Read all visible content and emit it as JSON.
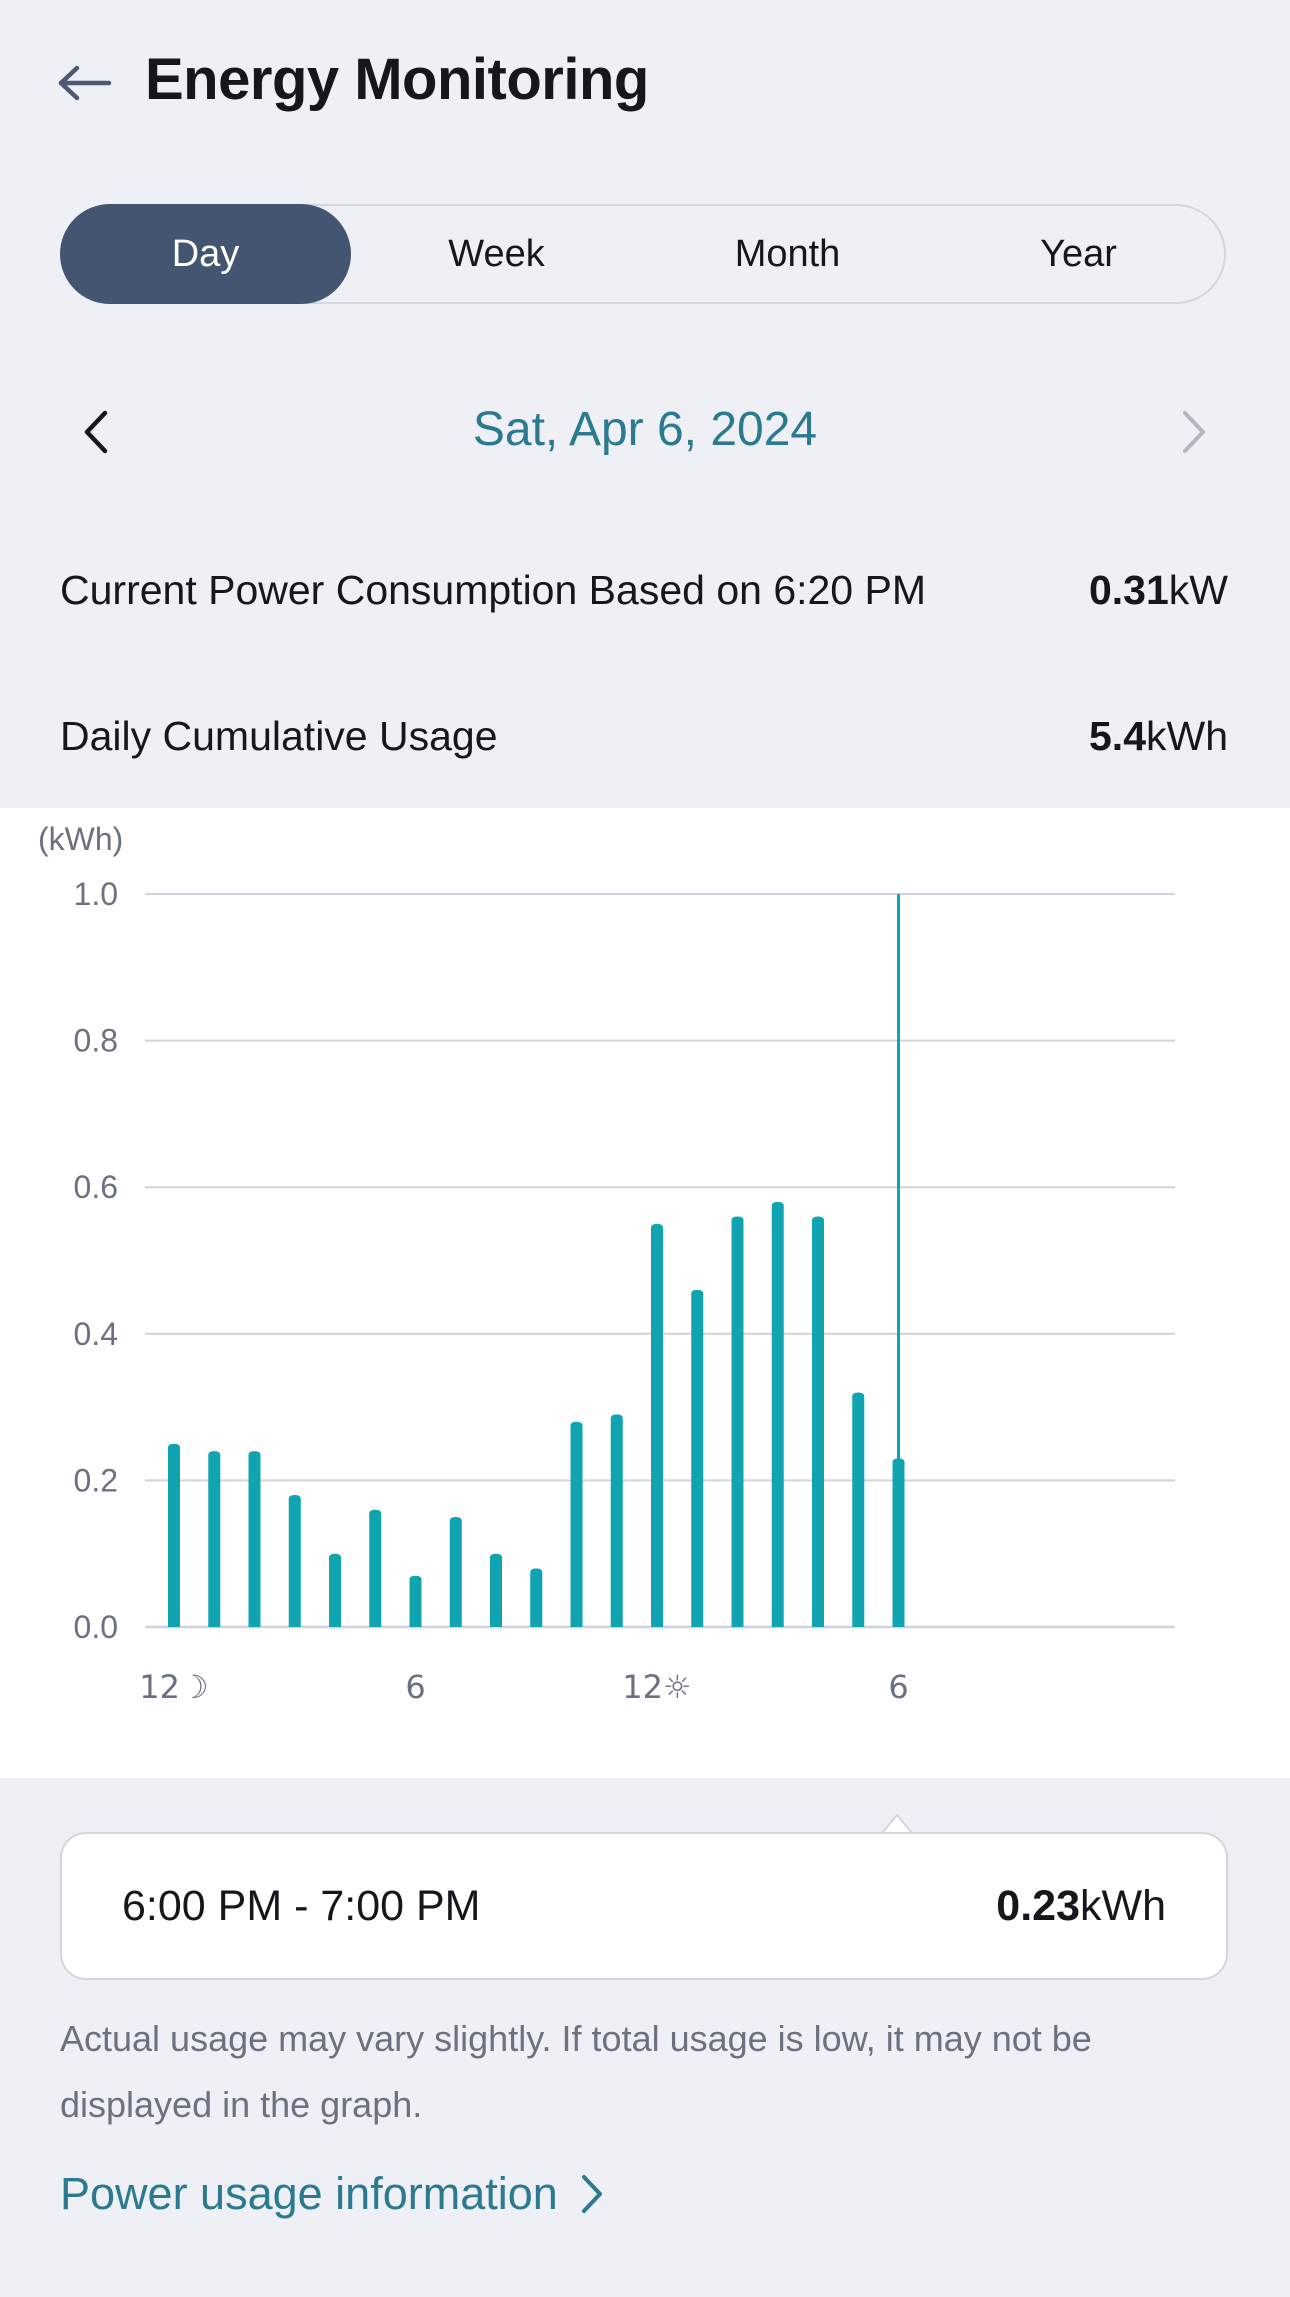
{
  "header": {
    "title": "Energy Monitoring",
    "back_icon": "arrow-left-icon"
  },
  "period_tabs": [
    {
      "label": "Day",
      "selected": true
    },
    {
      "label": "Week",
      "selected": false
    },
    {
      "label": "Month",
      "selected": false
    },
    {
      "label": "Year",
      "selected": false
    }
  ],
  "date_nav": {
    "date": "Sat, Apr 6, 2024",
    "prev_icon": "chevron-left-icon",
    "next_icon": "chevron-right-icon",
    "next_enabled": false
  },
  "current_power": {
    "label": "Current Power Consumption Based on 6:20 PM",
    "value": "0.31",
    "unit": "kW"
  },
  "daily_usage": {
    "label": "Daily Cumulative Usage",
    "value": "5.4",
    "unit": "kWh"
  },
  "chart_data": {
    "type": "bar",
    "ylabel": "(kWh)",
    "ylim": [
      0,
      1.0
    ],
    "yticks": [
      "0.0",
      "0.2",
      "0.4",
      "0.6",
      "0.8",
      "1.0"
    ],
    "x_tick_labels": [
      {
        "hour": 0,
        "label": "12☽"
      },
      {
        "hour": 6,
        "label": "6"
      },
      {
        "hour": 12,
        "label": "12☼"
      },
      {
        "hour": 18,
        "label": "6"
      }
    ],
    "hours": [
      0,
      1,
      2,
      3,
      4,
      5,
      6,
      7,
      8,
      9,
      10,
      11,
      12,
      13,
      14,
      15,
      16,
      17,
      18
    ],
    "values": [
      0.25,
      0.24,
      0.24,
      0.18,
      0.1,
      0.16,
      0.07,
      0.15,
      0.1,
      0.08,
      0.28,
      0.29,
      0.55,
      0.46,
      0.56,
      0.58,
      0.56,
      0.32,
      0.23
    ],
    "selected_hour": 18,
    "grid": true,
    "bar_color": "#10a4b0",
    "grid_color": "#d0d3dd"
  },
  "selection": {
    "range": "6:00 PM - 7:00 PM",
    "value": "0.23",
    "unit": "kWh"
  },
  "note": "Actual usage may vary slightly. If total usage is low, it may not be displayed in the graph.",
  "info_link": {
    "label": "Power usage information",
    "icon": "chevron-right-icon"
  },
  "colors": {
    "accent": "#2b7a8f",
    "tab_active": "#435571",
    "bar": "#10a4b0"
  }
}
